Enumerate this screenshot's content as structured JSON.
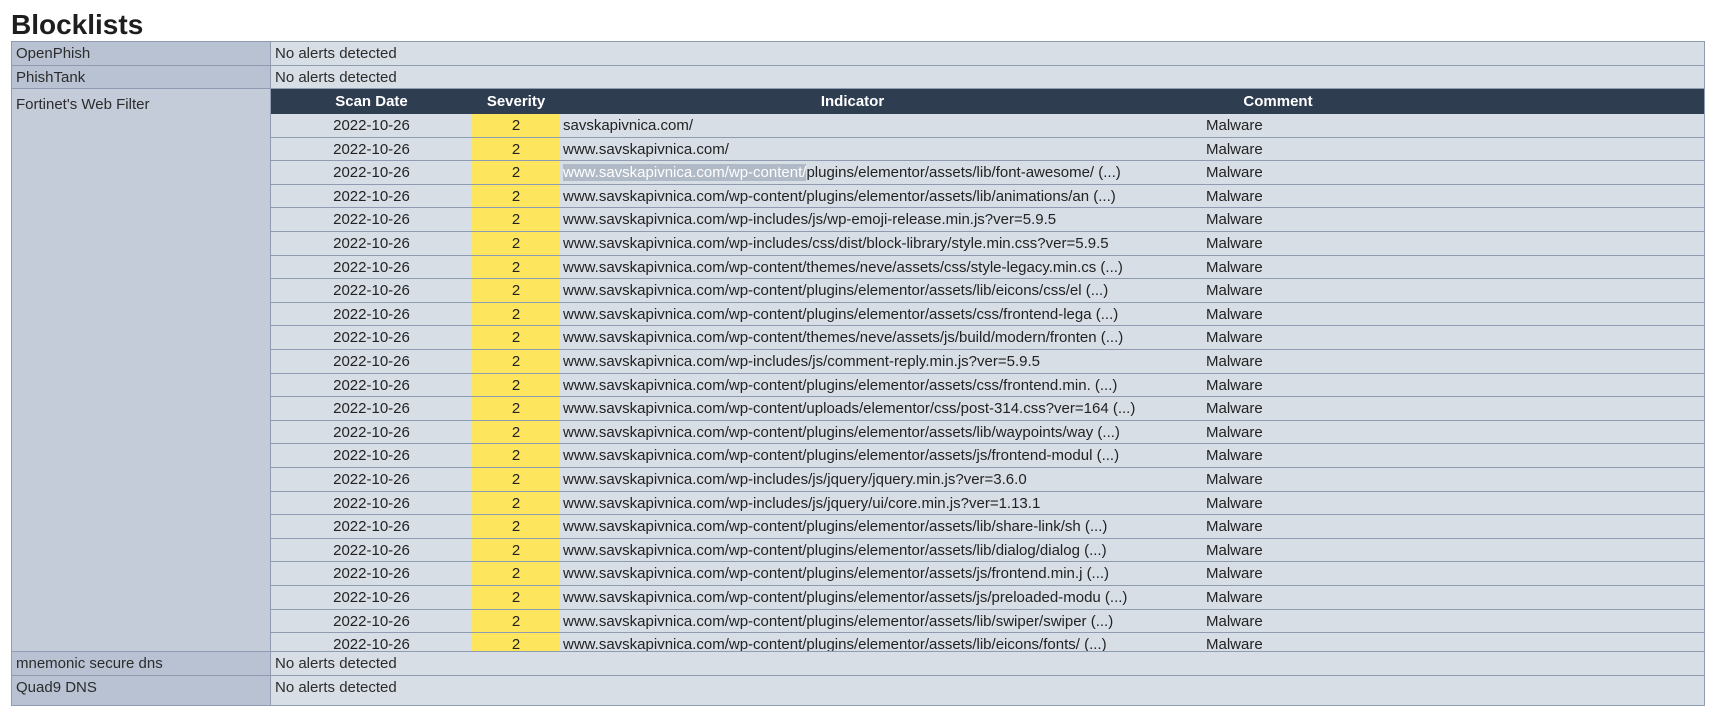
{
  "page_title": "Blocklists",
  "sources": {
    "openphish": {
      "name": "OpenPhish",
      "status": "No alerts detected"
    },
    "phishtank": {
      "name": "PhishTank",
      "status": "No alerts detected"
    },
    "fortinet": {
      "name": "Fortinet's Web Filter"
    },
    "mnemonic": {
      "name": "mnemonic secure dns",
      "status": "No alerts detected"
    },
    "quad9": {
      "name": "Quad9 DNS",
      "status": "No alerts detected"
    }
  },
  "table": {
    "headers": {
      "scan_date": "Scan Date",
      "severity": "Severity",
      "indicator": "Indicator",
      "comment": "Comment"
    },
    "rows": [
      {
        "date": "2022-10-26",
        "severity": "2",
        "indicator": "savskapivnica.com/",
        "comment": "Malware"
      },
      {
        "date": "2022-10-26",
        "severity": "2",
        "indicator": "www.savskapivnica.com/",
        "comment": "Malware"
      },
      {
        "date": "2022-10-26",
        "severity": "2",
        "indicator_hl": "www.savskapivnica.com/wp-content/",
        "indicator": "plugins/elementor/assets/lib/font-awesome/ (...)",
        "comment": "Malware"
      },
      {
        "date": "2022-10-26",
        "severity": "2",
        "indicator": "www.savskapivnica.com/wp-content/plugins/elementor/assets/lib/animations/an (...)",
        "comment": "Malware"
      },
      {
        "date": "2022-10-26",
        "severity": "2",
        "indicator": "www.savskapivnica.com/wp-includes/js/wp-emoji-release.min.js?ver=5.9.5",
        "comment": "Malware"
      },
      {
        "date": "2022-10-26",
        "severity": "2",
        "indicator": "www.savskapivnica.com/wp-includes/css/dist/block-library/style.min.css?ver=5.9.5",
        "comment": "Malware"
      },
      {
        "date": "2022-10-26",
        "severity": "2",
        "indicator": "www.savskapivnica.com/wp-content/themes/neve/assets/css/style-legacy.min.cs (...)",
        "comment": "Malware"
      },
      {
        "date": "2022-10-26",
        "severity": "2",
        "indicator": "www.savskapivnica.com/wp-content/plugins/elementor/assets/lib/eicons/css/el (...)",
        "comment": "Malware"
      },
      {
        "date": "2022-10-26",
        "severity": "2",
        "indicator": "www.savskapivnica.com/wp-content/plugins/elementor/assets/css/frontend-lega (...)",
        "comment": "Malware"
      },
      {
        "date": "2022-10-26",
        "severity": "2",
        "indicator": "www.savskapivnica.com/wp-content/themes/neve/assets/js/build/modern/fronten (...)",
        "comment": "Malware"
      },
      {
        "date": "2022-10-26",
        "severity": "2",
        "indicator": "www.savskapivnica.com/wp-includes/js/comment-reply.min.js?ver=5.9.5",
        "comment": "Malware"
      },
      {
        "date": "2022-10-26",
        "severity": "2",
        "indicator": "www.savskapivnica.com/wp-content/plugins/elementor/assets/css/frontend.min. (...)",
        "comment": "Malware"
      },
      {
        "date": "2022-10-26",
        "severity": "2",
        "indicator": "www.savskapivnica.com/wp-content/uploads/elementor/css/post-314.css?ver=164 (...)",
        "comment": "Malware"
      },
      {
        "date": "2022-10-26",
        "severity": "2",
        "indicator": "www.savskapivnica.com/wp-content/plugins/elementor/assets/lib/waypoints/way (...)",
        "comment": "Malware"
      },
      {
        "date": "2022-10-26",
        "severity": "2",
        "indicator": "www.savskapivnica.com/wp-content/plugins/elementor/assets/js/frontend-modul (...)",
        "comment": "Malware"
      },
      {
        "date": "2022-10-26",
        "severity": "2",
        "indicator": "www.savskapivnica.com/wp-includes/js/jquery/jquery.min.js?ver=3.6.0",
        "comment": "Malware"
      },
      {
        "date": "2022-10-26",
        "severity": "2",
        "indicator": "www.savskapivnica.com/wp-includes/js/jquery/ui/core.min.js?ver=1.13.1",
        "comment": "Malware"
      },
      {
        "date": "2022-10-26",
        "severity": "2",
        "indicator": "www.savskapivnica.com/wp-content/plugins/elementor/assets/lib/share-link/sh (...)",
        "comment": "Malware"
      },
      {
        "date": "2022-10-26",
        "severity": "2",
        "indicator": "www.savskapivnica.com/wp-content/plugins/elementor/assets/lib/dialog/dialog (...)",
        "comment": "Malware"
      },
      {
        "date": "2022-10-26",
        "severity": "2",
        "indicator": "www.savskapivnica.com/wp-content/plugins/elementor/assets/js/frontend.min.j (...)",
        "comment": "Malware"
      },
      {
        "date": "2022-10-26",
        "severity": "2",
        "indicator": "www.savskapivnica.com/wp-content/plugins/elementor/assets/js/preloaded-modu (...)",
        "comment": "Malware"
      },
      {
        "date": "2022-10-26",
        "severity": "2",
        "indicator": "www.savskapivnica.com/wp-content/plugins/elementor/assets/lib/swiper/swiper (...)",
        "comment": "Malware"
      },
      {
        "date": "2022-10-26",
        "severity": "2",
        "indicator": "www.savskapivnica.com/wp-content/plugins/elementor/assets/lib/eicons/fonts/ (...)",
        "comment": "Malware"
      }
    ]
  },
  "colors": {
    "header_bg": "#2e3d50",
    "severity_bg": "#fde65e",
    "row_bg": "#d8dee6"
  }
}
